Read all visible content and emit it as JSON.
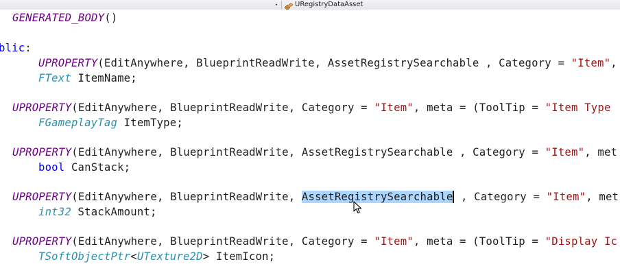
{
  "navbar": {
    "dropdown_arrow": "▾",
    "class_icon": "class-icon",
    "class_name": "URegistryDataAsset"
  },
  "code": {
    "line1": {
      "macro": "GENERATED_BODY",
      "rest": "()"
    },
    "line2": {
      "keyword": "blic",
      "rest": ":"
    },
    "line3": {
      "macro": "UPROPERTY",
      "part1": "(EditAnywhere, BlueprintReadWrite, AssetRegistrySearchable , Category = ",
      "string": "\"Item\"",
      "tail": ","
    },
    "line4": {
      "type": "FText",
      "rest": " ItemName;"
    },
    "line5": {
      "macro": "UPROPERTY",
      "part1": "(EditAnywhere, BlueprintReadWrite, Category = ",
      "string1": "\"Item\"",
      "part2": ", meta = (ToolTip = ",
      "string2": "\"Item Type"
    },
    "line6": {
      "type": "FGameplayTag",
      "rest": " ItemType;"
    },
    "line7": {
      "macro": "UPROPERTY",
      "part1": "(EditAnywhere, BlueprintReadWrite, AssetRegistrySearchable , Category = ",
      "string": "\"Item\"",
      "tail": ", met"
    },
    "line8": {
      "keyword": "bool",
      "rest": " CanStack;"
    },
    "line9": {
      "macro": "UPROPERTY",
      "part1": "(EditAnywhere, BlueprintReadWrite, ",
      "selected": "AssetRegistrySearchable",
      "part2": " , Category = ",
      "string": "\"Item\"",
      "tail": ", met"
    },
    "line10": {
      "type": "int32",
      "rest": " StackAmount;"
    },
    "line11": {
      "macro": "UPROPERTY",
      "part1": "(EditAnywhere, BlueprintReadWrite, Category = ",
      "string1": "\"Item\"",
      "part2": ", meta = (ToolTip = ",
      "string2": "\"Display Ic"
    },
    "line12": {
      "type1": "TSoftObjectPtr",
      "lt": "<",
      "type2": "UTexture2D",
      "rest": "> ItemIcon;"
    }
  },
  "colors": {
    "macro": "#6f008a",
    "type": "#2b91af",
    "keyword": "#0000ff",
    "string": "#a31515",
    "selection": "#add6ff",
    "text": "#1e1e1e"
  }
}
